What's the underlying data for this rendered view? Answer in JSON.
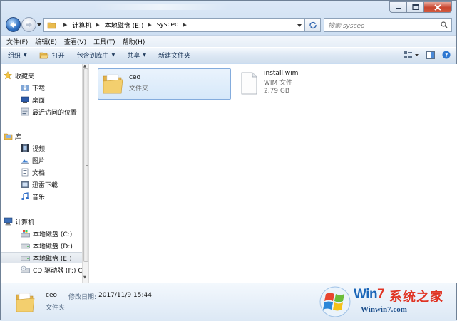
{
  "colors": {
    "accent": "#1e395b",
    "folder": "#f3c96a",
    "selection": "#d6e8fa"
  },
  "address": {
    "crumbs": [
      "计算机",
      "本地磁盘 (E:)",
      "sysceo"
    ]
  },
  "search": {
    "placeholder": "搜索 sysceo"
  },
  "menubar": [
    "文件(F)",
    "编辑(E)",
    "查看(V)",
    "工具(T)",
    "帮助(H)"
  ],
  "toolbar": {
    "organize": "组织",
    "open": "打开",
    "include_in_library": "包含到库中",
    "share": "共享",
    "new_folder": "新建文件夹"
  },
  "nav": {
    "favorites": {
      "label": "收藏夹",
      "items": [
        "下载",
        "桌面",
        "最近访问的位置"
      ]
    },
    "libraries": {
      "label": "库",
      "items": [
        "视频",
        "图片",
        "文档",
        "迅雷下载",
        "音乐"
      ]
    },
    "computer": {
      "label": "计算机",
      "items": [
        "本地磁盘 (C:)",
        "本地磁盘 (D:)",
        "本地磁盘 (E:)",
        "CD 驱动器 (F:) C"
      ]
    }
  },
  "files": [
    {
      "name": "ceo",
      "type": "文件夹",
      "icon": "folder-icon",
      "selected": true
    },
    {
      "name": "install.wim",
      "type": "WIM 文件",
      "size": "2.79 GB",
      "icon": "file-icon",
      "selected": false
    }
  ],
  "details": {
    "name": "ceo",
    "modified_label": "修改日期:",
    "modified_value": "2017/11/9 15:44",
    "type": "文件夹"
  },
  "watermark": {
    "brand_win": "Win",
    "brand_seven": "7",
    "brand_cn": "系统之家",
    "url": "Winwin7.com"
  }
}
